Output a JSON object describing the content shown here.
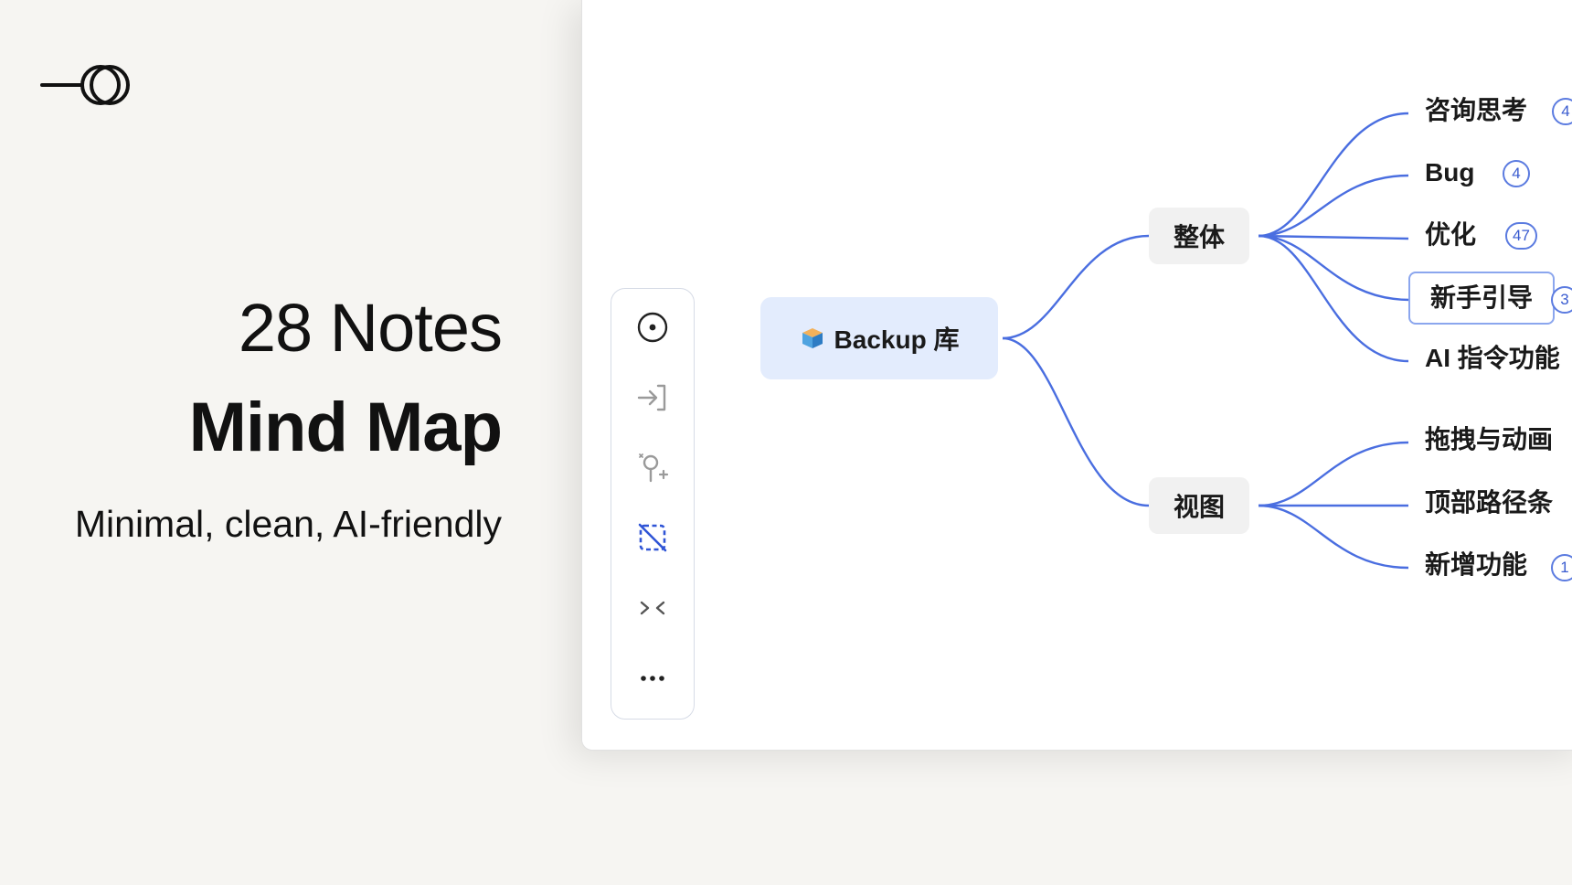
{
  "hero": {
    "count": "28 Notes",
    "title": "Mind Map",
    "tagline": "Minimal, clean, AI-friendly"
  },
  "toolbar": {
    "tools": [
      {
        "name": "focus-icon"
      },
      {
        "name": "enter-icon"
      },
      {
        "name": "add-node-icon"
      },
      {
        "name": "deselect-icon",
        "active": true
      },
      {
        "name": "collapse-icon"
      },
      {
        "name": "more-icon"
      }
    ]
  },
  "mindmap": {
    "root": {
      "label": "Backup 库",
      "icon": "box-icon"
    },
    "branches": [
      {
        "label": "整体",
        "children": [
          {
            "label": "咨询思考",
            "count": "4"
          },
          {
            "label": "Bug",
            "count": "4"
          },
          {
            "label": "优化",
            "count": "47"
          },
          {
            "label": "新手引导",
            "count": "3",
            "selected": true
          },
          {
            "label": "AI 指令功能"
          }
        ]
      },
      {
        "label": "视图",
        "children": [
          {
            "label": "拖拽与动画"
          },
          {
            "label": "顶部路径条"
          },
          {
            "label": "新增功能",
            "count": "1"
          }
        ]
      }
    ]
  },
  "colors": {
    "background": "#f6f5f2",
    "link": "#4a6ee0",
    "root_fill": "#e3ecfd",
    "branch_fill": "#f1f1f1",
    "accent": "#2f54d6"
  }
}
